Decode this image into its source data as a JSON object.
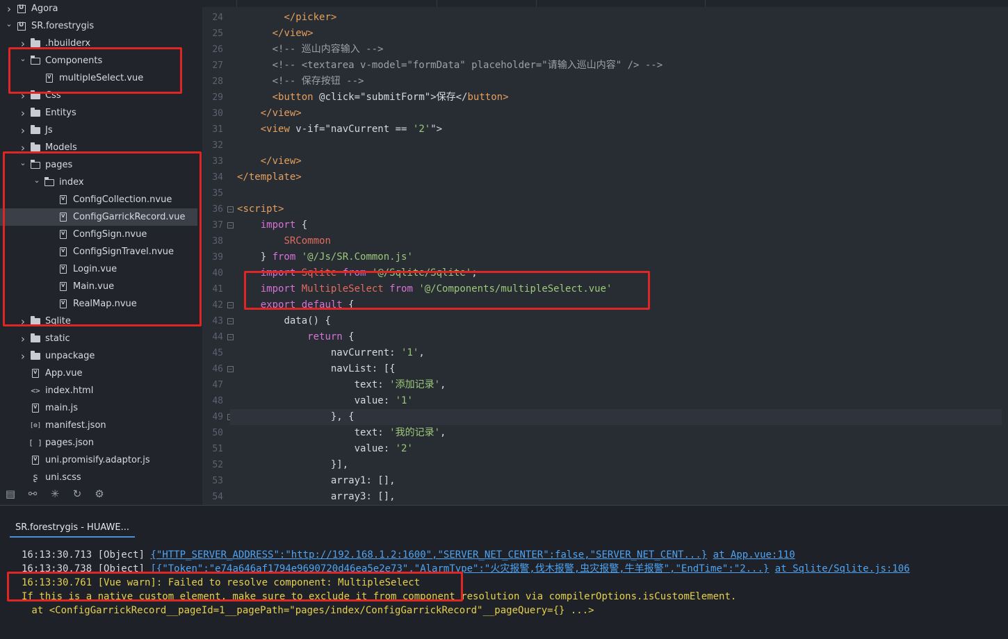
{
  "sidebar": {
    "tree": [
      {
        "label": "Agora",
        "kind": "project",
        "expanded": false
      },
      {
        "label": "SR.forestrygis",
        "kind": "project",
        "expanded": true
      },
      {
        "label": ".hbuilderx",
        "kind": "folder",
        "expanded": false
      },
      {
        "label": "Components",
        "kind": "folder",
        "expanded": true
      },
      {
        "label": "multipleSelect.vue",
        "kind": "file"
      },
      {
        "label": "Css",
        "kind": "folder",
        "expanded": false
      },
      {
        "label": "Entitys",
        "kind": "folder",
        "expanded": false
      },
      {
        "label": "Js",
        "kind": "folder",
        "expanded": false
      },
      {
        "label": "Models",
        "kind": "folder",
        "expanded": false
      },
      {
        "label": "pages",
        "kind": "folder",
        "expanded": true
      },
      {
        "label": "index",
        "kind": "folder",
        "expanded": true
      },
      {
        "label": "ConfigCollection.nvue",
        "kind": "file"
      },
      {
        "label": "ConfigGarrickRecord.vue",
        "kind": "file",
        "selected": true
      },
      {
        "label": "ConfigSign.nvue",
        "kind": "file"
      },
      {
        "label": "ConfigSignTravel.nvue",
        "kind": "file"
      },
      {
        "label": "Login.vue",
        "kind": "file"
      },
      {
        "label": "Main.vue",
        "kind": "file"
      },
      {
        "label": "RealMap.nvue",
        "kind": "file"
      },
      {
        "label": "Sqlite",
        "kind": "folder",
        "expanded": false
      },
      {
        "label": "static",
        "kind": "folder",
        "expanded": false
      },
      {
        "label": "unpackage",
        "kind": "folder",
        "expanded": false
      },
      {
        "label": "App.vue",
        "kind": "file"
      },
      {
        "label": "index.html",
        "kind": "html"
      },
      {
        "label": "main.js",
        "kind": "js"
      },
      {
        "label": "manifest.json",
        "kind": "manifest"
      },
      {
        "label": "pages.json",
        "kind": "json"
      },
      {
        "label": "uni.promisify.adaptor.js",
        "kind": "js"
      },
      {
        "label": "uni.scss",
        "kind": "scss"
      }
    ],
    "toolbar_icons": [
      "project-manager-icon",
      "binoculars-icon",
      "bug-icon",
      "sync-icon",
      "plugin-icon"
    ]
  },
  "editor": {
    "lines": [
      {
        "n": "24",
        "fold": false,
        "tokens": [
          [
            "        ",
            "p"
          ],
          [
            "</",
            "tag"
          ],
          [
            "picker",
            "tag"
          ],
          [
            ">",
            "tag"
          ]
        ]
      },
      {
        "n": "25",
        "fold": false,
        "tokens": [
          [
            "      ",
            "p"
          ],
          [
            "</",
            "tag"
          ],
          [
            "view",
            "tag"
          ],
          [
            ">",
            "tag"
          ]
        ]
      },
      {
        "n": "26",
        "fold": false,
        "tokens": [
          [
            "      ",
            "p"
          ],
          [
            "<!-- 巡山内容输入 -->",
            "cm"
          ]
        ]
      },
      {
        "n": "27",
        "fold": false,
        "tokens": [
          [
            "      ",
            "p"
          ],
          [
            "<!-- <textarea v-model=\"formData\" placeholder=\"请输入巡山内容\" /> -->",
            "cm"
          ]
        ]
      },
      {
        "n": "28",
        "fold": false,
        "tokens": [
          [
            "      ",
            "p"
          ],
          [
            "<!-- 保存按钮 -->",
            "cm"
          ]
        ]
      },
      {
        "n": "29",
        "fold": false,
        "tokens": [
          [
            "      ",
            "p"
          ],
          [
            "<",
            "tag"
          ],
          [
            "button",
            "tag"
          ],
          [
            " @click=",
            "attr"
          ],
          [
            "\"submitForm\"",
            "attr"
          ],
          [
            ">保存</",
            "attr"
          ],
          [
            "button",
            "tag"
          ],
          [
            ">",
            "tag"
          ]
        ]
      },
      {
        "n": "30",
        "fold": false,
        "tokens": [
          [
            "    ",
            "p"
          ],
          [
            "</",
            "tag"
          ],
          [
            "view",
            "tag"
          ],
          [
            ">",
            "tag"
          ]
        ]
      },
      {
        "n": "31",
        "fold": false,
        "tokens": [
          [
            "    ",
            "p"
          ],
          [
            "<",
            "tag"
          ],
          [
            "view",
            "tag"
          ],
          [
            " v-if=",
            "attr"
          ],
          [
            "\"navCurrent == ",
            "attr"
          ],
          [
            "'2'",
            "str"
          ],
          [
            "\">",
            "attr"
          ]
        ]
      },
      {
        "n": "32",
        "fold": false,
        "tokens": []
      },
      {
        "n": "33",
        "fold": false,
        "tokens": [
          [
            "    ",
            "p"
          ],
          [
            "</",
            "tag"
          ],
          [
            "view",
            "tag"
          ],
          [
            ">",
            "tag"
          ]
        ]
      },
      {
        "n": "34",
        "fold": false,
        "tokens": [
          [
            "</",
            "tag"
          ],
          [
            "template",
            "tag"
          ],
          [
            ">",
            "tag"
          ]
        ]
      },
      {
        "n": "35",
        "fold": false,
        "tokens": []
      },
      {
        "n": "36",
        "fold": true,
        "tokens": [
          [
            "<",
            "tag"
          ],
          [
            "script",
            "tag"
          ],
          [
            ">",
            "tag"
          ]
        ]
      },
      {
        "n": "37",
        "fold": true,
        "tokens": [
          [
            "    ",
            "p"
          ],
          [
            "import",
            "kw"
          ],
          [
            " {",
            "p"
          ]
        ]
      },
      {
        "n": "38",
        "fold": false,
        "tokens": [
          [
            "        ",
            "p"
          ],
          [
            "SRCommon",
            "name"
          ]
        ]
      },
      {
        "n": "39",
        "fold": false,
        "tokens": [
          [
            "    } ",
            "p"
          ],
          [
            "from",
            "kw"
          ],
          [
            " ",
            "p"
          ],
          [
            "'@/Js/SR.Common.js'",
            "str"
          ]
        ]
      },
      {
        "n": "40",
        "fold": false,
        "tokens": [
          [
            "    ",
            "p"
          ],
          [
            "import",
            "kw"
          ],
          [
            " Sqlite ",
            "name"
          ],
          [
            "from",
            "kw"
          ],
          [
            " ",
            "p"
          ],
          [
            "'@/Sqlite/Sqlite'",
            "str"
          ],
          [
            ";",
            "p"
          ]
        ]
      },
      {
        "n": "41",
        "fold": false,
        "tokens": [
          [
            "    ",
            "p"
          ],
          [
            "import",
            "kw"
          ],
          [
            " MultipleSelect ",
            "name"
          ],
          [
            "from",
            "kw"
          ],
          [
            " ",
            "p"
          ],
          [
            "'@/Components/multipleSelect.vue'",
            "str"
          ]
        ]
      },
      {
        "n": "42",
        "fold": true,
        "tokens": [
          [
            "    ",
            "p"
          ],
          [
            "export",
            "kw"
          ],
          [
            " ",
            "p"
          ],
          [
            "default",
            "kw"
          ],
          [
            " {",
            "p"
          ]
        ]
      },
      {
        "n": "43",
        "fold": true,
        "tokens": [
          [
            "        ",
            "p"
          ],
          [
            "data",
            "key"
          ],
          [
            "() {",
            "p"
          ]
        ]
      },
      {
        "n": "44",
        "fold": true,
        "tokens": [
          [
            "            ",
            "p"
          ],
          [
            "return",
            "kw"
          ],
          [
            " {",
            "p"
          ]
        ]
      },
      {
        "n": "45",
        "fold": false,
        "tokens": [
          [
            "                ",
            "p"
          ],
          [
            "navCurrent",
            "key"
          ],
          [
            ": ",
            "p"
          ],
          [
            "'1'",
            "str"
          ],
          [
            ",",
            "p"
          ]
        ]
      },
      {
        "n": "46",
        "fold": true,
        "tokens": [
          [
            "                ",
            "p"
          ],
          [
            "navList",
            "key"
          ],
          [
            ": [{",
            "p"
          ]
        ]
      },
      {
        "n": "47",
        "fold": false,
        "tokens": [
          [
            "                    ",
            "p"
          ],
          [
            "text",
            "key"
          ],
          [
            ": ",
            "p"
          ],
          [
            "'添加记录'",
            "str"
          ],
          [
            ",",
            "p"
          ]
        ]
      },
      {
        "n": "48",
        "fold": false,
        "tokens": [
          [
            "                    ",
            "p"
          ],
          [
            "value",
            "key"
          ],
          [
            ": ",
            "p"
          ],
          [
            "'1'",
            "str"
          ]
        ]
      },
      {
        "n": "49",
        "fold": true,
        "highlight": true,
        "tokens": [
          [
            "                ",
            "p"
          ],
          [
            "}, {",
            "p"
          ]
        ]
      },
      {
        "n": "50",
        "fold": false,
        "tokens": [
          [
            "                    ",
            "p"
          ],
          [
            "text",
            "key"
          ],
          [
            ": ",
            "p"
          ],
          [
            "'我的记录'",
            "str"
          ],
          [
            ",",
            "p"
          ]
        ]
      },
      {
        "n": "51",
        "fold": false,
        "tokens": [
          [
            "                    ",
            "p"
          ],
          [
            "value",
            "key"
          ],
          [
            ": ",
            "p"
          ],
          [
            "'2'",
            "str"
          ]
        ]
      },
      {
        "n": "52",
        "fold": false,
        "tokens": [
          [
            "                ",
            "p"
          ],
          [
            "}],",
            "p"
          ]
        ]
      },
      {
        "n": "53",
        "fold": false,
        "tokens": [
          [
            "                ",
            "p"
          ],
          [
            "array1",
            "key"
          ],
          [
            ": [],",
            "p"
          ]
        ]
      },
      {
        "n": "54",
        "fold": false,
        "tokens": [
          [
            "                ",
            "p"
          ],
          [
            "array3",
            "key"
          ],
          [
            ": [],",
            "p"
          ]
        ]
      }
    ]
  },
  "console": {
    "tab_label": "SR.forestrygis - HUAWE...",
    "lines": [
      {
        "time": "16:13:30.713",
        "type": "[Object]",
        "payload": "{\"HTTP_SERVER_ADDRESS\":\"http://192.168.1.2:1600\",\"SERVER_NET_CENTER\":false,\"SERVER_NET_CENT...}",
        "source": "at App.vue:110"
      },
      {
        "time": "16:13:30.738",
        "type": "[Object]",
        "payload": "[{\"Token\":\"e74a646af1794e9690720d46ea5e2e73\",\"AlarmType\":\"火灾报警,伐木报警,虫灾报警,牛羊报警\",\"EndTime\":\"2...}",
        "source": "at Sqlite/Sqlite.js:106"
      }
    ],
    "warn_main": "16:13:30.761 [Vue warn]: Failed to resolve component: MultipleSelect",
    "warn_hint": "If this is a native custom element, make sure to exclude it from component resolution via compilerOptions.isCustomElement.",
    "warn_trace": " at <ConfigGarrickRecord__pageId=1__pagePath=\"pages/index/ConfigGarrickRecord\"__pageQuery={} ...>"
  },
  "colors": {
    "annotation_red": "#e02525",
    "link_blue": "#4ea4f5",
    "warn_yellow": "#e6d14a"
  }
}
